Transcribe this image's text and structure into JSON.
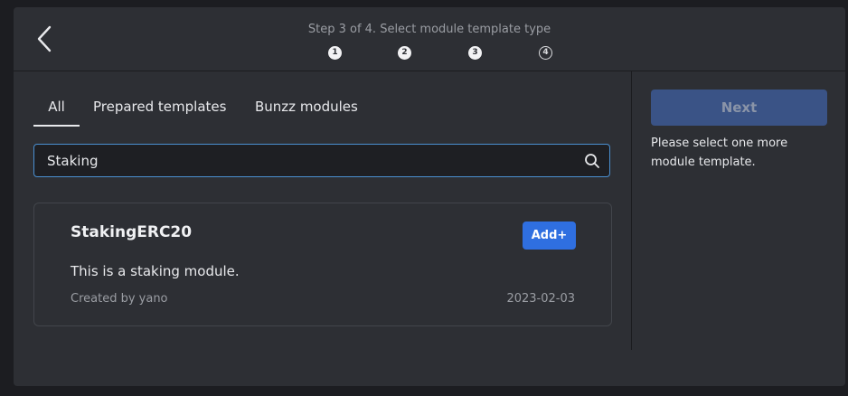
{
  "header": {
    "step_title": "Step 3 of 4. Select module template type",
    "steps": [
      {
        "number": "1",
        "state": "done"
      },
      {
        "number": "2",
        "state": "done"
      },
      {
        "number": "3",
        "state": "current"
      },
      {
        "number": "4",
        "state": "upcoming"
      }
    ],
    "back_icon": "chevron-left-icon"
  },
  "tabs": [
    {
      "label": "All",
      "active": true
    },
    {
      "label": "Prepared templates",
      "active": false
    },
    {
      "label": "Bunzz modules",
      "active": false
    }
  ],
  "search": {
    "value": "Staking",
    "icon": "search-icon"
  },
  "results": [
    {
      "title": "StakingERC20",
      "add_label": "Add+",
      "description": "This is a staking module.",
      "author": "Created by yano",
      "date": "2023-02-03"
    }
  ],
  "sidebar": {
    "next_label": "Next",
    "next_enabled": false,
    "hint": "Please select one more module template."
  },
  "colors": {
    "background": "#2d2f34",
    "accent_blue": "#2f6fe0",
    "disabled_blue": "#3a5386",
    "search_border": "#4a8fd0"
  }
}
